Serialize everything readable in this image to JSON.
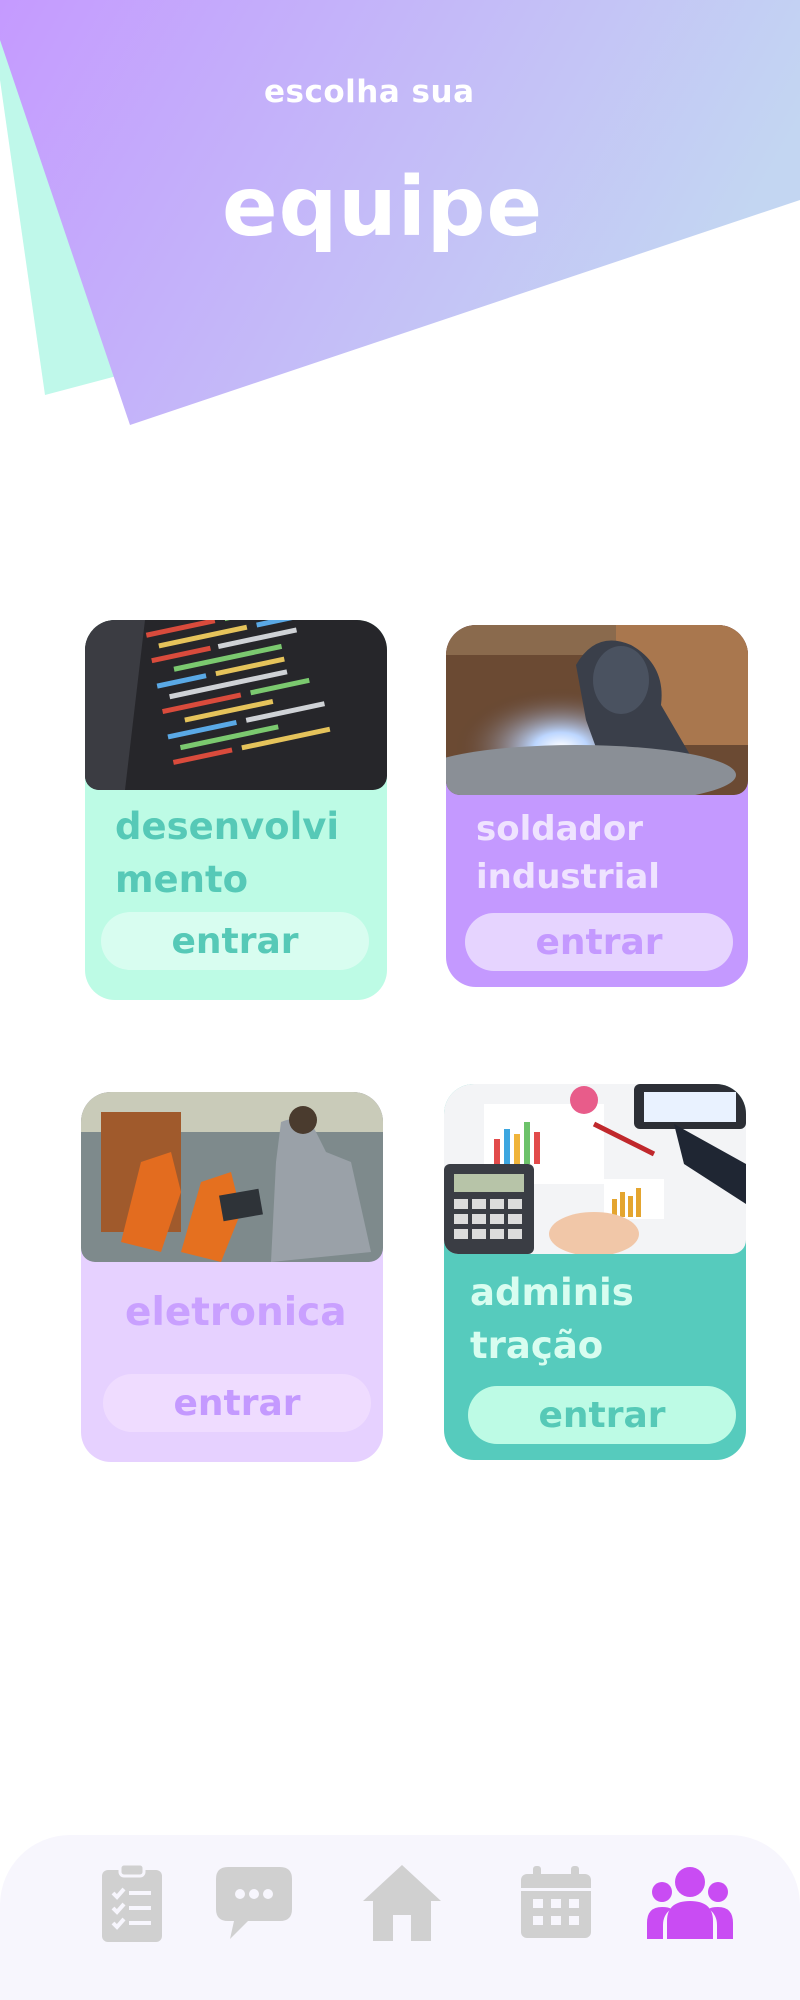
{
  "header": {
    "subtitle": "escolha sua",
    "title": "equipe"
  },
  "teams": [
    {
      "label_line1": "desenvolvi",
      "label_line2": "mento",
      "button": "entrar",
      "photo": "code-screen-photo"
    },
    {
      "label_line1": "soldador",
      "label_line2": "industrial",
      "button": "entrar",
      "photo": "welder-photo"
    },
    {
      "label_line1": "eletronica",
      "button": "entrar",
      "photo": "factory-robots-photo"
    },
    {
      "label_line1": "adminis",
      "label_line2": "tração",
      "button": "entrar",
      "photo": "calculator-charts-photo"
    }
  ],
  "nav": {
    "items": [
      {
        "icon": "clipboard-icon",
        "active": false
      },
      {
        "icon": "chat-bubble-icon",
        "active": false
      },
      {
        "icon": "home-icon",
        "active": false
      },
      {
        "icon": "calendar-icon",
        "active": false
      },
      {
        "icon": "team-icon",
        "active": true
      }
    ]
  },
  "colors": {
    "hero_gradient_start": "#c59aff",
    "hero_gradient_end": "#c3d6f2",
    "hero_back_layer": "#bff8ea",
    "mint": "#bdfbe5",
    "teal": "#56cbbd",
    "purple": "#c499ff",
    "lavender": "#e6d1ff",
    "nav_inactive": "#d0d0d0",
    "nav_active": "#c94cf3"
  }
}
